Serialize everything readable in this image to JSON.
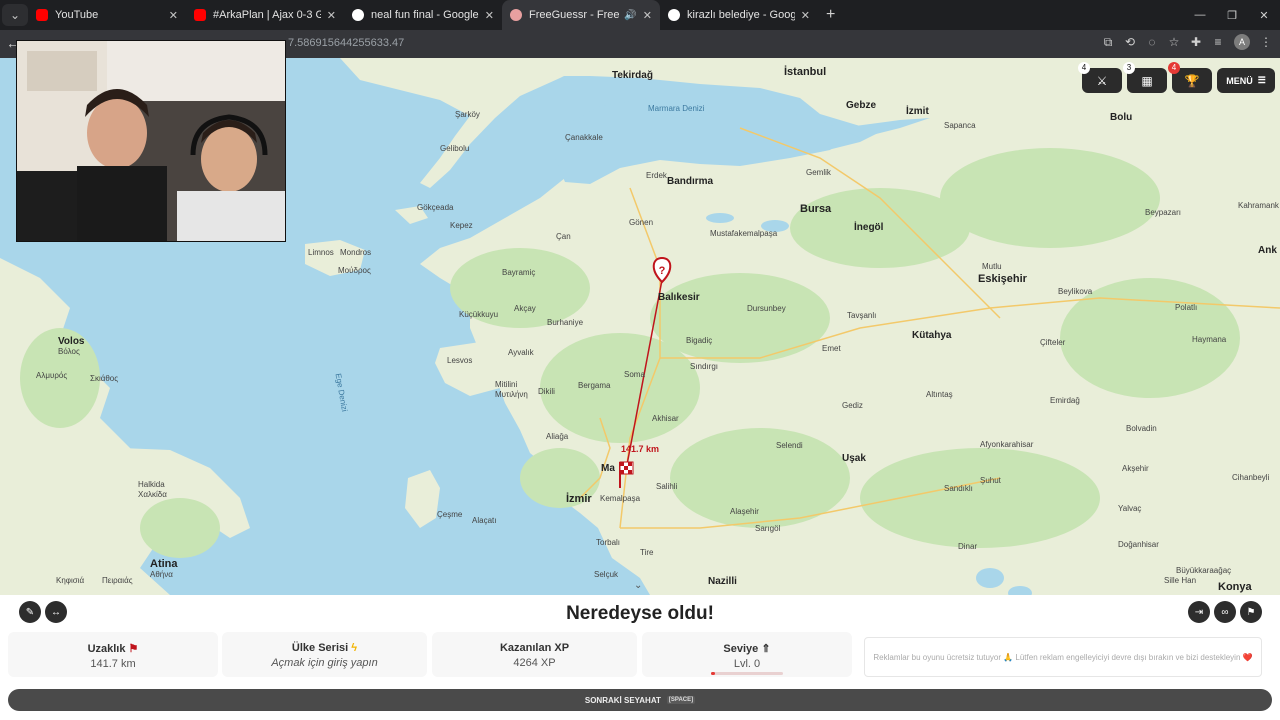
{
  "browser": {
    "tabs": [
      {
        "title": "YouTube",
        "favicon_color": "#ff0000",
        "active": false,
        "sound": false
      },
      {
        "title": "#ArkaPlan | Ajax 0-3 Galatasa",
        "favicon_color": "#ff0000",
        "active": false,
        "sound": false
      },
      {
        "title": "neal fun final - Google'da Ara",
        "favicon_color": "#ffffff",
        "active": false,
        "sound": false
      },
      {
        "title": "FreeGuessr - Free GeoGuess",
        "favicon_color": "#e8a0a0",
        "active": true,
        "sound": true
      },
      {
        "title": "kirazlı belediye - Google'da Ara",
        "favicon_color": "#ffffff",
        "active": false,
        "sound": false
      }
    ],
    "url_visible": "7.586915644255633.47",
    "account_initial": "A"
  },
  "map": {
    "distance_label": "141.7 km",
    "sea_labels": [
      "Marmara Denizi",
      "Ege Denizi"
    ],
    "labels": {
      "tekirdag": "Tekirdağ",
      "istanbul": "İstanbul",
      "gebze": "Gebze",
      "izmit": "İzmit",
      "sapanca": "Sapanca",
      "bolu": "Bolu",
      "sarkoy": "Şarköy",
      "gelibolu": "Gelibolu",
      "canakkale": "Çanakkale",
      "erdek": "Erdek",
      "bandirma": "Bandırma",
      "bursa": "Bursa",
      "gemlik": "Gemlik",
      "inegol": "İnegöl",
      "beypazari": "Beypazarı",
      "kahramank": "Kahramank",
      "gokceada": "Gökçeada",
      "kepez": "Kepez",
      "can": "Çan",
      "gonen": "Gönen",
      "mustafakemalpasa": "Mustafakemalpaşa",
      "eskisehir": "Eskişehir",
      "mutlu": "Mutlu",
      "ank": "Ank",
      "limnos": "Limnos",
      "mondros": "Mondros",
      "mondros_gr": "Μούδρος",
      "bayramic": "Bayramiç",
      "balikesir": "Balıkesir",
      "kucukkuyu": "Küçükkuyu",
      "akcay": "Akçay",
      "burhaniye": "Burhaniye",
      "dursunbey": "Dursunbey",
      "tavsanli": "Tavşanlı",
      "beylikova": "Beylikova",
      "polatli": "Polatlı",
      "volos": "Volos",
      "volos_gr": "Βόλος",
      "ayvalik": "Ayvalık",
      "bigadic": "Bigadiç",
      "kutahya": "Kütahya",
      "cifteler": "Çifteler",
      "haymana": "Haymana",
      "skiathos": "Σκιάθος",
      "akrpos": "Αλμυρός",
      "lesvos": "Lesvos",
      "sindirgi": "Sındırgı",
      "emet": "Emet",
      "soma": "Soma",
      "mitilini": "Mitilini",
      "mitilini_gr": "Μυτιλήνη",
      "dikili": "Dikili",
      "bergama": "Bergama",
      "altintas": "Altıntaş",
      "emirdag": "Emirdağ",
      "gediz": "Gediz",
      "aliaga": "Aliağa",
      "akhisar": "Akhisar",
      "afyon": "Afyonkarahisar",
      "bolvadin": "Bolvadin",
      "manisa": "Ma",
      "selendi": "Selendi",
      "usak": "Uşak",
      "halkida": "Halkida",
      "halkida_gr": "Χαλκίδα",
      "salihli": "Salihli",
      "izmir": "İzmir",
      "kemalpasa": "Kemalpaşa",
      "cesme": "Çeşme",
      "alacati": "Alaçatı",
      "sandikli": "Sandıklı",
      "suhut": "Şuhut",
      "yalvac": "Yalvaç",
      "aksehir": "Akşehir",
      "cihanbeyli": "Cihanbeyli",
      "alasehir": "Alaşehir",
      "torbali": "Torbalı",
      "sangol": "Sarıgöl",
      "tire": "Tire",
      "dinar": "Dinar",
      "athina": "Atina",
      "athina_gr": "Αθήνα",
      "kifisia": "Κηφισιά",
      "pireas": "Πειραιάς",
      "selcuk": "Selçuk",
      "nazilli": "Nazilli",
      "konya": "Konya",
      "buyukkaraagac": "Büyükkaraağaç",
      "silehan": "Sille Han",
      "dogankent": "Doğanhisar"
    }
  },
  "header_buttons": {
    "battle_badge": "4",
    "shop_badge": "3",
    "trophy_badge": "4",
    "menu_label": "MENÜ"
  },
  "result": {
    "title": "Neredeyse oldu!",
    "stats": [
      {
        "heading": "Uzaklık",
        "value": "141.7 km"
      },
      {
        "heading": "Ülke Serisi",
        "value": "Açmak için giriş yapın"
      },
      {
        "heading": "Kazanılan XP",
        "value": "4264 XP"
      },
      {
        "heading": "Seviye",
        "value": "Lvl. 0"
      }
    ],
    "ad_text": "Reklamlar bu oyunu ücretsiz tutuyor 🙏 Lütfen reklam engelleyiciyi devre dışı bırakın ve bizi destekleyin ❤️",
    "next_label": "SONRAKİ SEYAHAT",
    "next_key": "[SPACE]"
  },
  "colors": {
    "route": "#c0141c",
    "sea": "#a9d6ea",
    "land": "#e9eed9",
    "forest": "#c8e4b4",
    "level_bar": "#e53935"
  }
}
